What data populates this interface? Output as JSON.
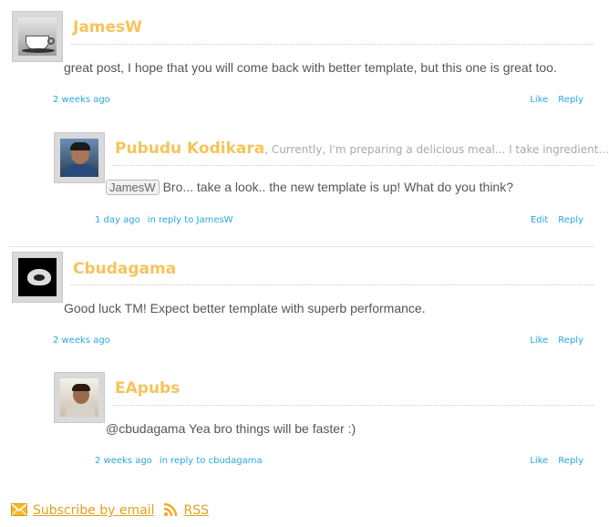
{
  "comments": [
    {
      "author": "JamesW",
      "tagline": "",
      "text": "great post, I hope that you will come back with better template, but this one is great too.",
      "time": "2 weeks ago",
      "in_reply_to": "",
      "actions": [
        "Like",
        "Reply"
      ]
    },
    {
      "author": "Pubudu Kodikara",
      "tagline": ", Currently, I'm preparing a delicious meal... I take ingredient...",
      "mention": "JamesW",
      "text": "Bro... take a look.. the new template is up! What do you think?",
      "time": "1 day ago",
      "in_reply_to": "in reply to JamesW",
      "actions": [
        "Edit",
        "Reply"
      ]
    },
    {
      "author": "Cbudagama",
      "tagline": "",
      "text": "Good luck TM! Expect better template with superb performance.",
      "time": "2 weeks ago",
      "in_reply_to": "",
      "actions": [
        "Like",
        "Reply"
      ]
    },
    {
      "author": "EApubs",
      "tagline": "",
      "text": "@cbudagama Yea bro things will be faster :)",
      "time": "2 weeks ago",
      "in_reply_to": "in reply to cbudagama",
      "actions": [
        "Like",
        "Reply"
      ]
    }
  ],
  "footer": {
    "subscribe_label": "Subscribe by email",
    "rss_label": "RSS",
    "icons": [
      "mail-icon",
      "rss-icon"
    ],
    "accent_color": "#e2a11c"
  },
  "colors": {
    "author": "#f6c35c",
    "link": "#29a8e0",
    "text": "#555555"
  }
}
